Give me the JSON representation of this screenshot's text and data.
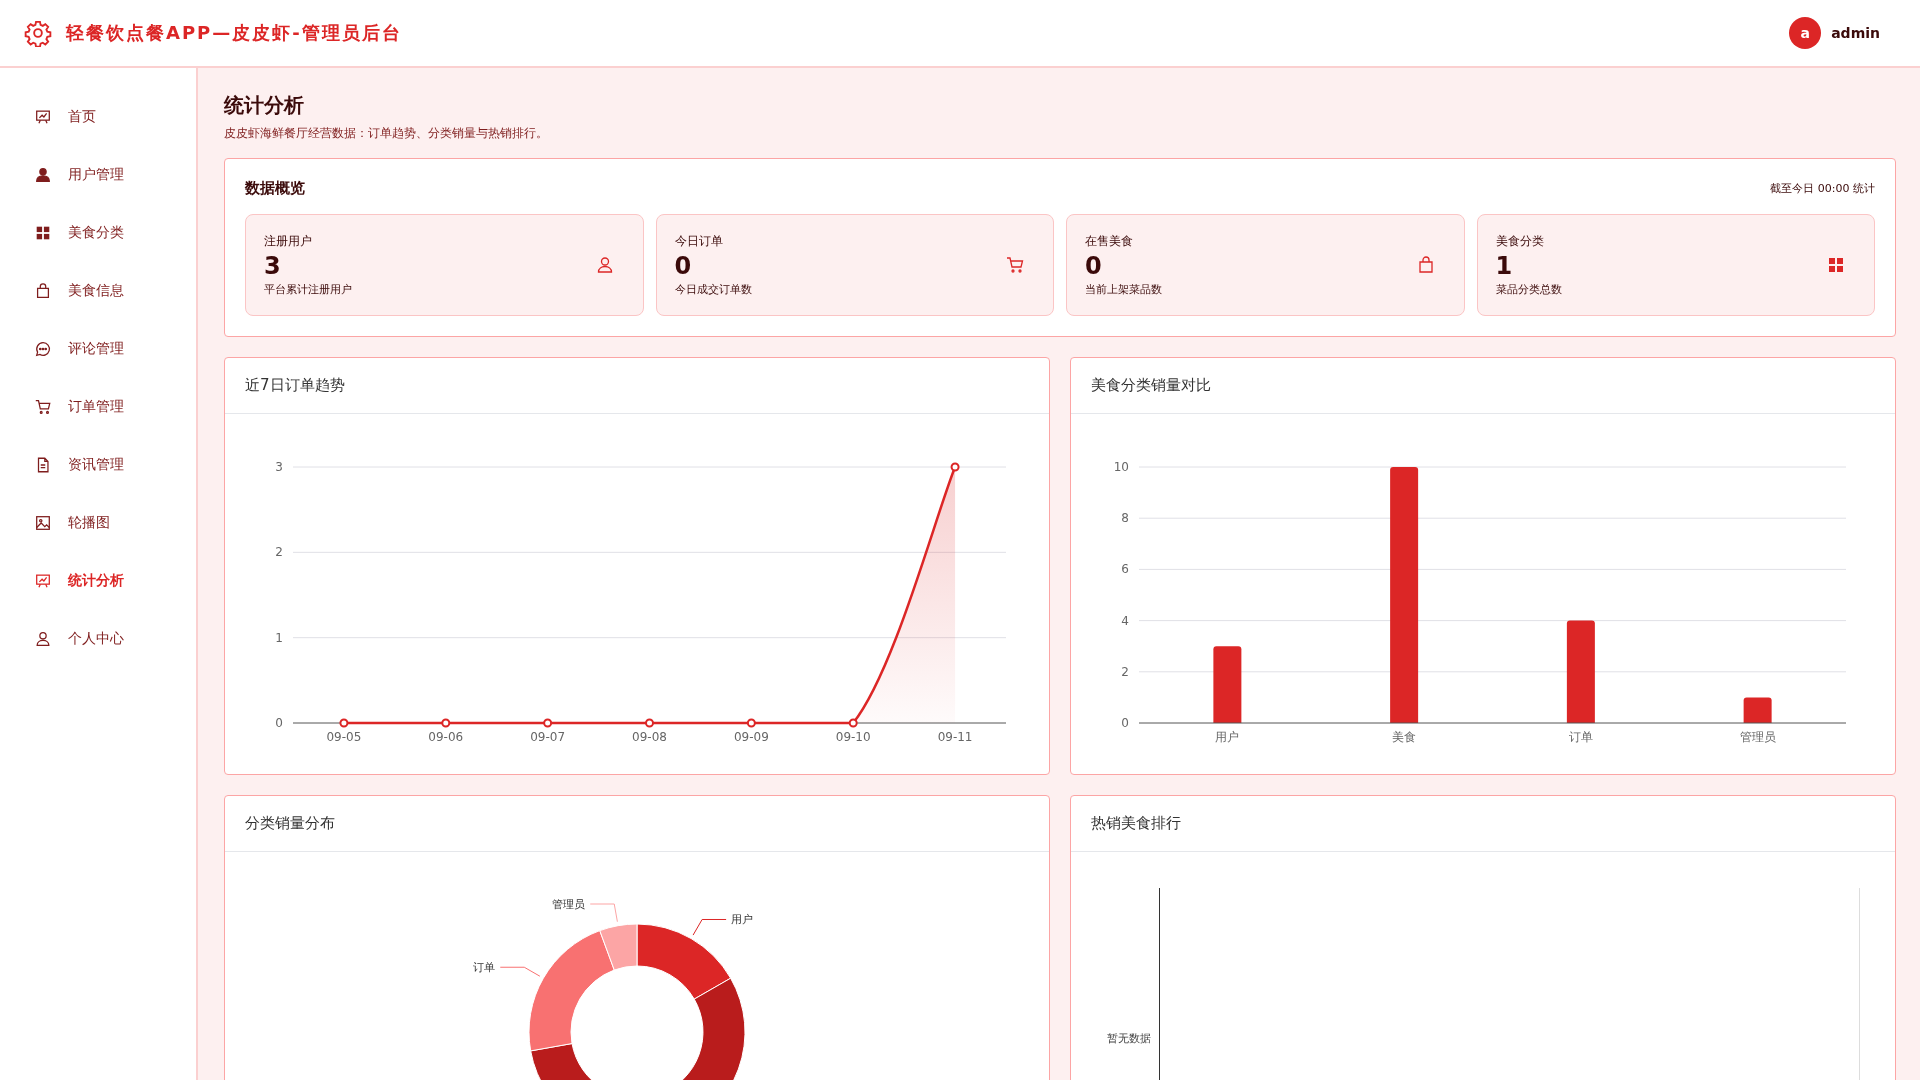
{
  "header": {
    "title": "轻餐饮点餐APP—皮皮虾-管理员后台",
    "avatar_letter": "a",
    "username": "admin"
  },
  "sidebar": {
    "items": [
      {
        "label": "首页",
        "selected": false
      },
      {
        "label": "用户管理",
        "selected": false
      },
      {
        "label": "美食分类",
        "selected": false
      },
      {
        "label": "美食信息",
        "selected": false
      },
      {
        "label": "评论管理",
        "selected": false
      },
      {
        "label": "订单管理",
        "selected": false
      },
      {
        "label": "资讯管理",
        "selected": false
      },
      {
        "label": "轮播图",
        "selected": false
      },
      {
        "label": "统计分析",
        "selected": true
      },
      {
        "label": "个人中心",
        "selected": false
      }
    ]
  },
  "page": {
    "title": "统计分析",
    "subtitle": "皮皮虾海鲜餐厅经营数据：订单趋势、分类销量与热销排行。"
  },
  "overview": {
    "title": "数据概览",
    "note": "截至今日 00:00 统计",
    "cards": [
      {
        "label": "注册用户",
        "value": "3",
        "caption": "平台累计注册用户",
        "kind": "user"
      },
      {
        "label": "今日订单",
        "value": "0",
        "caption": "今日成交订单数",
        "kind": "cart"
      },
      {
        "label": "在售美食",
        "value": "0",
        "caption": "当前上架菜品数",
        "kind": "bag"
      },
      {
        "label": "美食分类",
        "value": "1",
        "caption": "菜品分类总数",
        "kind": "grid"
      }
    ]
  },
  "trend_panel": {
    "title": "近7日订单趋势",
    "chart_data": {
      "type": "area",
      "categories": [
        "09-05",
        "09-06",
        "09-07",
        "09-08",
        "09-09",
        "09-10",
        "09-11"
      ],
      "series": [
        {
          "color": "#dc2626",
          "values": [
            0,
            0,
            0,
            0,
            0,
            0,
            3
          ]
        }
      ],
      "ylim": [
        0,
        3
      ],
      "yticks": [
        0,
        1,
        2,
        3
      ],
      "grid": true
    }
  },
  "category_panel": {
    "title": "美食分类销量对比",
    "chart_data": {
      "type": "bar",
      "categories": [
        "用户",
        "美食",
        "订单",
        "管理员"
      ],
      "series": [
        {
          "color": "#dc2626",
          "values": [
            3,
            10,
            4,
            1
          ]
        }
      ],
      "ylim": [
        0,
        10
      ],
      "yticks": [
        0,
        2,
        4,
        6,
        8,
        10
      ],
      "grid": true
    }
  },
  "distribution_panel": {
    "title": "分类销量分布",
    "chart_data": {
      "type": "donut",
      "categories": [
        "用户",
        null,
        "订单",
        "管理员"
      ],
      "values": [
        16.7,
        55.5,
        22.2,
        5.6
      ],
      "colors": [
        "#dc2626",
        "#b91c1c",
        "#f87171",
        "#fca5a5"
      ]
    }
  },
  "ranking_panel": {
    "title": "热销美食排行",
    "empty_text": "暂无数据"
  }
}
